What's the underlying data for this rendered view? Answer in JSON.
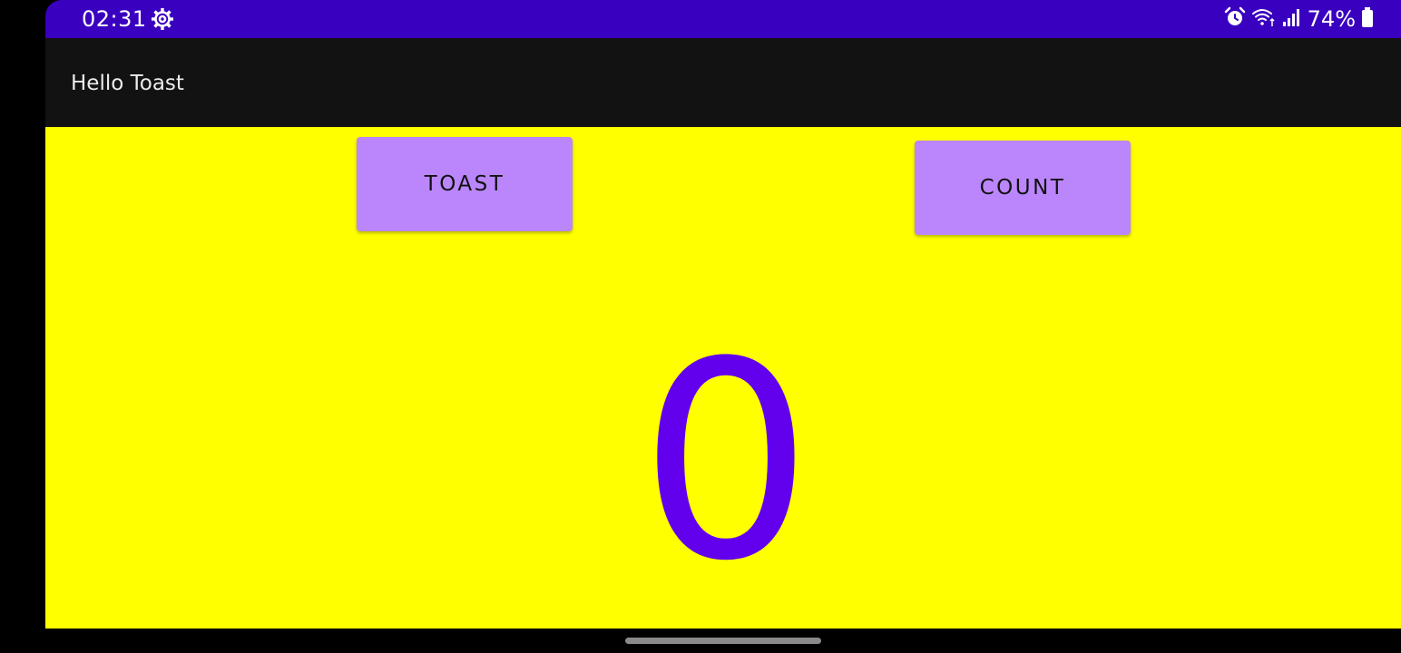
{
  "status_bar": {
    "time": "02:31",
    "battery_percent": "74%",
    "icons": [
      "settings-gear-icon",
      "alarm-icon",
      "wifi-icon",
      "cell-signal-icon",
      "battery-icon"
    ]
  },
  "app_bar": {
    "title": "Hello Toast"
  },
  "main": {
    "toast_button_label": "TOAST",
    "count_button_label": "COUNT",
    "count_value": "0"
  },
  "colors": {
    "status_bar": "#3a00c0",
    "app_bar": "#121212",
    "background": "#ffff00",
    "button": "#bb86fc",
    "count_text": "#6200ee"
  }
}
